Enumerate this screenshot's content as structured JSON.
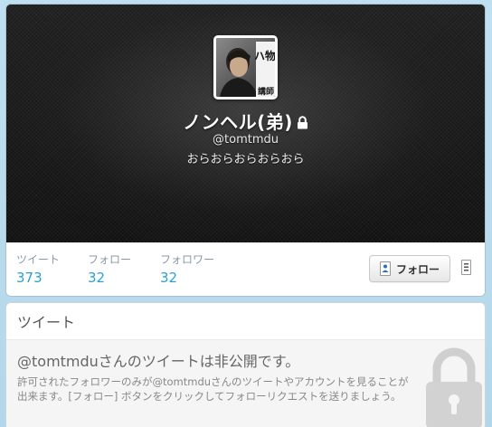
{
  "profile": {
    "name": "ノンヘル(弟)",
    "screen_name": "@tomtmdu",
    "bio": "おらおらおらおらおら",
    "avatar_text_top": "ハ物",
    "avatar_text_bottom": "講師："
  },
  "stats": [
    {
      "label": "ツイート",
      "value": "373"
    },
    {
      "label": "フォロー",
      "value": "32"
    },
    {
      "label": "フォロワー",
      "value": "32"
    }
  ],
  "actions": {
    "follow_label": "フォロー"
  },
  "tweets": {
    "header": "ツイート",
    "protected_title": "@tomtmduさんのツイートは非公開です。",
    "protected_desc_line1": "許可されたフォロワーのみが@tomtmduさんのツイートやアカウントを見ることが",
    "protected_desc_line2": "出来ます。[フォロー] ボタンをクリックしてフォローリクエストを送りましょう。"
  },
  "icons": {
    "protected": "lock-icon",
    "follow": "follow-user-icon",
    "more": "more-actions-icon",
    "big_lock": "padlock-icon"
  },
  "colors": {
    "link_blue": "#2a9fd6",
    "header_bg": "#141414",
    "page_bg": "#c0deed"
  }
}
